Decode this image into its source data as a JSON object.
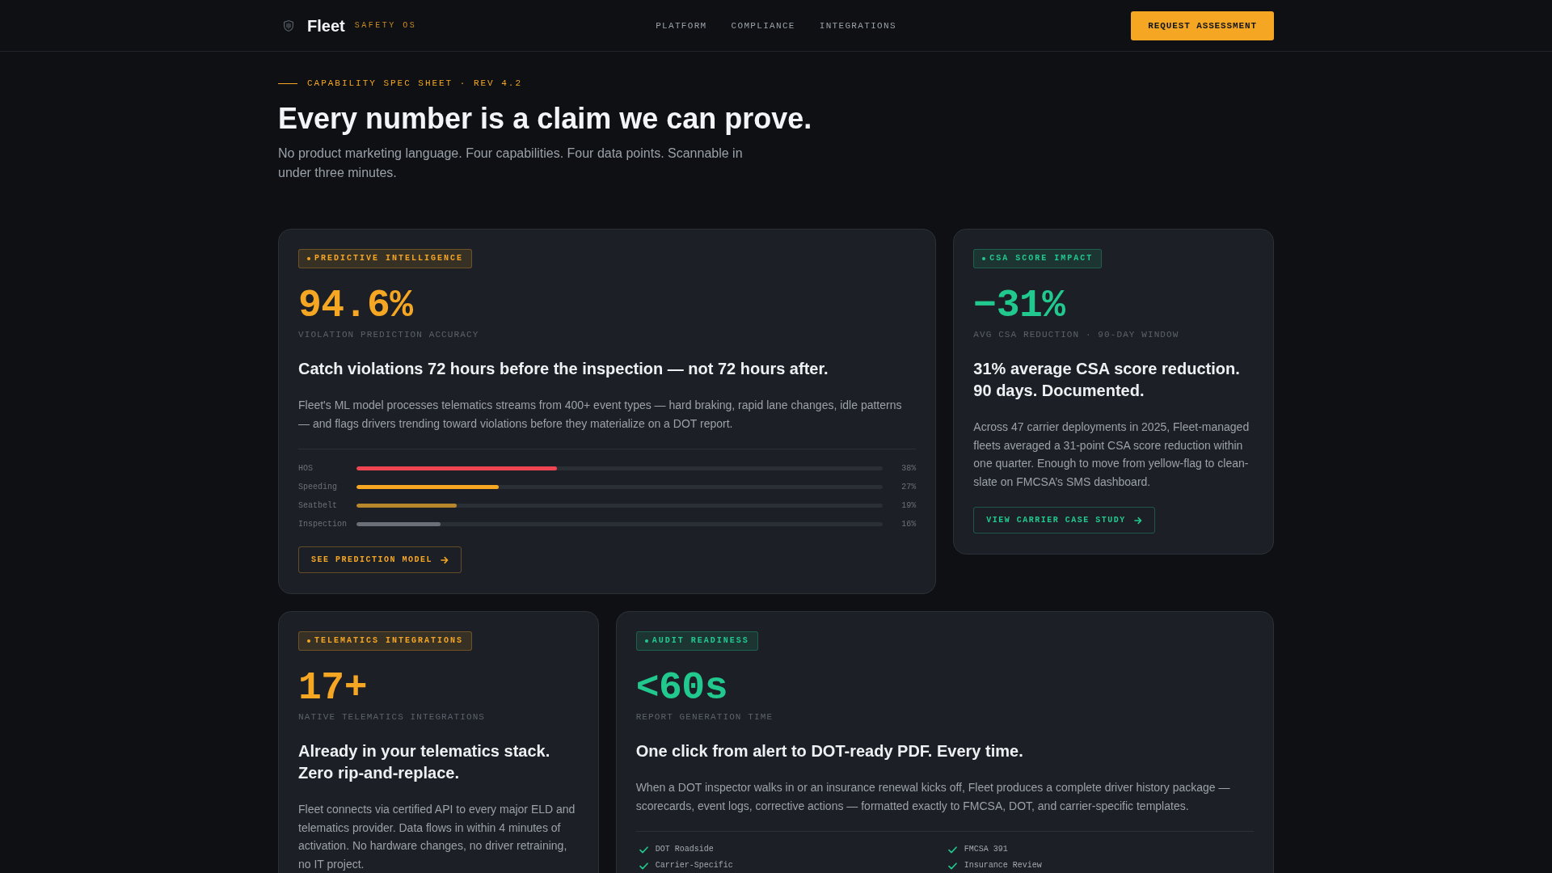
{
  "header": {
    "brand": "Fleet",
    "tagline": "SAFETY OS",
    "nav": [
      "PLATFORM",
      "COMPLIANCE",
      "INTEGRATIONS"
    ],
    "cta": "REQUEST ASSESSMENT"
  },
  "hero": {
    "eyebrow": "CAPABILITY SPEC SHEET · REV 4.2",
    "title": "Every number is a claim we can prove.",
    "subtitle": "No product marketing language. Four capabilities. Four data points. Scannable in under three minutes."
  },
  "capabilities": [
    {
      "kind": "breakdown",
      "color": "#f5a623",
      "badge": "PREDICTIVE INTELLIGENCE",
      "metric": "94.6%",
      "metric_label": "VIOLATION PREDICTION ACCURACY",
      "headline": "Catch violations 72 hours before the inspection — not 72 hours after.",
      "body": "Fleet's ML model processes telematics streams from 400+ event types — hard braking, rapid lane changes, idle patterns — and flags drivers trending toward violations before they materialize on a DOT report.",
      "breakdown": [
        {
          "label": "HOS",
          "level": 0.38,
          "value": "38%",
          "color": "#ef4452"
        },
        {
          "label": "Speeding",
          "level": 0.27,
          "value": "27%",
          "color": "#f5a623"
        },
        {
          "label": "Seatbelt",
          "level": 0.19,
          "value": "19%",
          "color": "#b8862b"
        },
        {
          "label": "Inspection",
          "level": 0.16,
          "value": "16%",
          "color": "#6b7078"
        }
      ],
      "link": "SEE PREDICTION MODEL"
    },
    {
      "kind": "plain",
      "color": "#22c98e",
      "badge": "CSA SCORE IMPACT",
      "metric": "−31%",
      "metric_label": "AVG CSA REDUCTION · 90-DAY WINDOW",
      "headline": "31% average CSA score reduction. 90 days. Documented.",
      "body": "Across 47 carrier deployments in 2025, Fleet-managed fleets averaged a 31-point CSA score reduction within one quarter. Enough to move from yellow-flag to clean-slate on FMCSA’s SMS dashboard.",
      "link": "VIEW CARRIER CASE STUDY"
    },
    {
      "kind": "plain",
      "color": "#f5a623",
      "badge": "TELEMATICS INTEGRATIONS",
      "metric": "17+",
      "metric_label": "NATIVE TELEMATICS INTEGRATIONS",
      "headline": "Already in your telematics stack. Zero rip-and-replace.",
      "body": "Fleet connects via certified API to every major ELD and telematics provider. Data flows in within 4 minutes of activation. No hardware changes, no driver retraining, no IT project."
    },
    {
      "kind": "checklist",
      "color": "#22c98e",
      "badge": "AUDIT READINESS",
      "metric": "<60s",
      "metric_label": "REPORT GENERATION TIME",
      "headline": "One click from alert to DOT-ready PDF. Every time.",
      "body": "When a DOT inspector walks in or an insurance renewal kicks off, Fleet produces a complete driver history package — scorecards, event logs, corrective actions — formatted exactly to FMCSA, DOT, and carrier-specific templates.",
      "checks": [
        "DOT Roadside",
        "FMCSA 391",
        "Carrier-Specific",
        "Insurance Review"
      ]
    }
  ]
}
